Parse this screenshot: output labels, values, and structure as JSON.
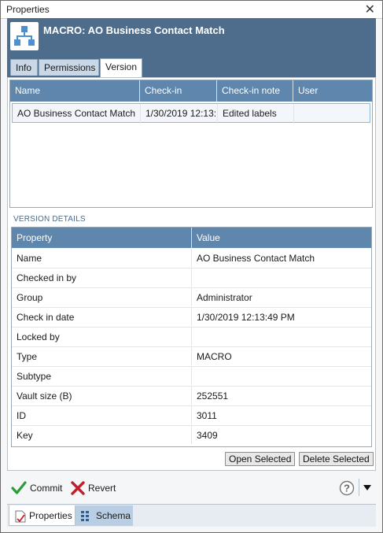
{
  "window": {
    "title": "Properties",
    "close_glyph": "✕"
  },
  "header": {
    "title": "MACRO: AO Business Contact Match",
    "icon": "macro-hierarchy-icon",
    "bg_color": "#4e6d8d"
  },
  "tabs": [
    {
      "label": "Info",
      "active": false
    },
    {
      "label": "Permissions",
      "active": false
    },
    {
      "label": "Version",
      "active": true
    }
  ],
  "versions_grid": {
    "columns": [
      "Name",
      "Check-in",
      "Check-in note",
      "User"
    ],
    "rows": [
      [
        "AO Business Contact Match",
        "1/30/2019 12:13:",
        "Edited labels",
        ""
      ]
    ]
  },
  "version_details": {
    "section_label": "VERSION DETAILS",
    "columns": [
      "Property",
      "Value"
    ],
    "rows": [
      [
        "Name",
        "AO Business Contact Match"
      ],
      [
        "Checked in by",
        ""
      ],
      [
        "Group",
        "Administrator"
      ],
      [
        "Check in date",
        "1/30/2019 12:13:49 PM"
      ],
      [
        "Locked by",
        ""
      ],
      [
        "Type",
        "MACRO"
      ],
      [
        "Subtype",
        ""
      ],
      [
        "Vault size (B)",
        "252551"
      ],
      [
        "ID",
        "3011"
      ],
      [
        "Key",
        "3409"
      ]
    ]
  },
  "buttons": {
    "open_selected": "Open Selected",
    "delete_selected": "Delete Selected"
  },
  "footer": {
    "commit": "Commit",
    "revert": "Revert",
    "help_icon": "help-circle-icon",
    "menu_icon": "triangle-down-icon"
  },
  "bottom_tabs": [
    {
      "label": "Properties",
      "icon": "properties-doc-icon",
      "active": true
    },
    {
      "label": "Schema",
      "icon": "schema-grid-icon",
      "active": false
    }
  ],
  "colors": {
    "grid_header": "#5f86ad",
    "commit_check": "#2e9a3b",
    "revert_x": "#c0202a",
    "accent": "#4e6d8d"
  }
}
